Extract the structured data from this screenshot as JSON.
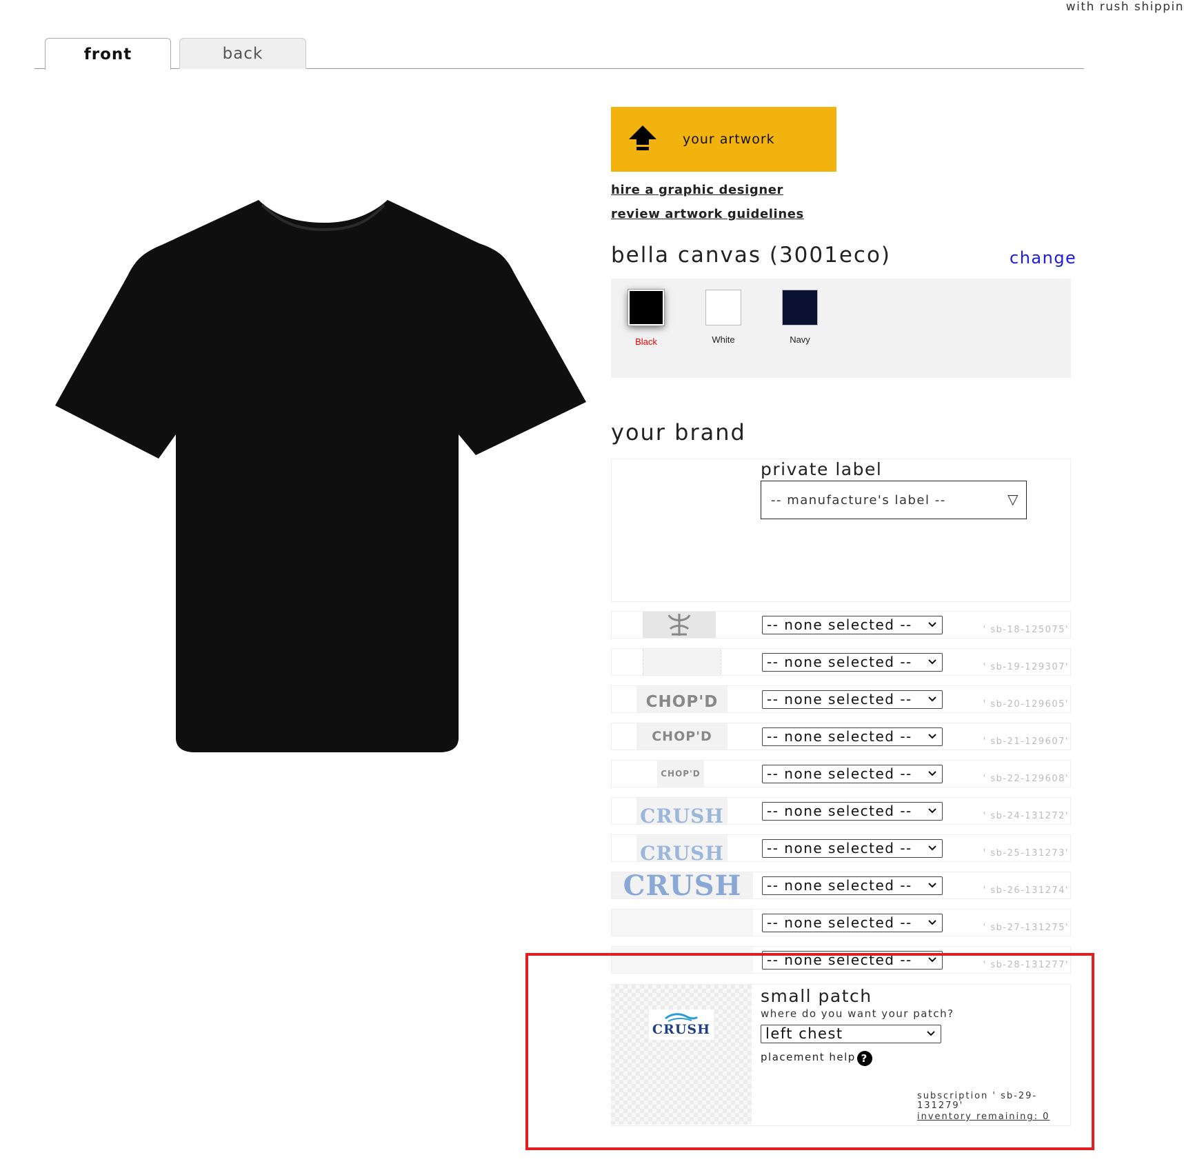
{
  "top_note": "with rush shippin",
  "tabs": [
    {
      "label": "front",
      "active": true
    },
    {
      "label": "back",
      "active": false
    }
  ],
  "artwork": {
    "upload_label": "your artwork",
    "hire_link": "hire a graphic designer",
    "guidelines_link": "review artwork guidelines",
    "accent_color": "#F3B30F"
  },
  "product": {
    "title": "bella canvas  (3001eco)",
    "change_label": "change",
    "colors": [
      {
        "name": "Black",
        "hex": "#000000",
        "selected": true
      },
      {
        "name": "White",
        "hex": "#FFFFFF",
        "selected": false
      },
      {
        "name": "Navy",
        "hex": "#0B1130",
        "selected": false
      }
    ]
  },
  "brand": {
    "title": "your brand",
    "private_label": {
      "label": "private label",
      "value": "-- manufacture's label --"
    },
    "rows": [
      {
        "thumb": "logo-mark",
        "value": "-- none selected --",
        "code": "' sb-18-125075'"
      },
      {
        "thumb": "blank",
        "value": "-- none selected --",
        "code": "' sb-19-129307'"
      },
      {
        "thumb": "chopd-large",
        "thumb_text": "CHOP'D",
        "value": "-- none selected --",
        "code": "' sb-20-129605'"
      },
      {
        "thumb": "chopd-medium",
        "thumb_text": "CHOP'D",
        "value": "-- none selected --",
        "code": "' sb-21-129607'"
      },
      {
        "thumb": "chopd-small",
        "thumb_text": "CHOP'D",
        "value": "-- none selected --",
        "code": "' sb-22-129608'"
      },
      {
        "thumb": "crush-cropped",
        "thumb_text": "CRUSH",
        "value": "-- none selected --",
        "code": "' sb-24-131272'"
      },
      {
        "thumb": "crush-cropped",
        "thumb_text": "CRUSH",
        "value": "-- none selected --",
        "code": "' sb-25-131273'"
      },
      {
        "thumb": "crush-large",
        "thumb_text": "CRUSH",
        "value": "-- none selected --",
        "code": "' sb-26-131274'"
      },
      {
        "thumb": "blank-checker",
        "value": "-- none selected --",
        "code": "' sb-27-131275'"
      },
      {
        "thumb": "blank-checker",
        "value": "-- none selected --",
        "code": "' sb-28-131277'"
      }
    ],
    "patch": {
      "thumb_text": "CRUSH",
      "title": "small patch",
      "question": "where do you want your patch?",
      "placement_value": "left chest",
      "help_label": "placement help",
      "help_icon": "?",
      "subscription_text": "subscription ' sb-29-131279'",
      "inventory_link": "inventory remaining: 0"
    }
  },
  "highlight_color": "#E02020"
}
